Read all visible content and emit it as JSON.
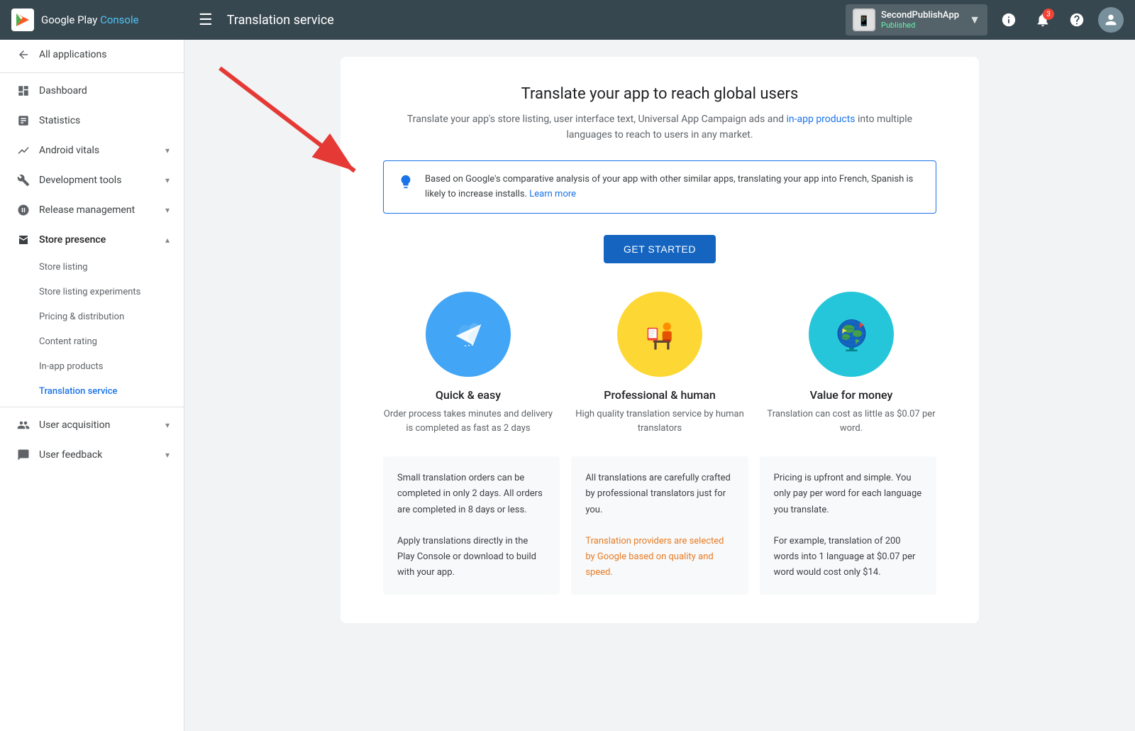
{
  "header": {
    "hamburger": "☰",
    "page_title": "Translation service",
    "app": {
      "name": "SecondPublishApp",
      "status": "Published",
      "chevron": "▼"
    },
    "icons": {
      "help": "?",
      "notifications_badge": "3",
      "help2": "?"
    }
  },
  "sidebar": {
    "logo_text_1": "Google Play",
    "logo_text_2": "Console",
    "nav": [
      {
        "id": "all-apps",
        "label": "All applications",
        "icon": "←",
        "level": 0
      },
      {
        "id": "dashboard",
        "label": "Dashboard",
        "icon": "⊞",
        "level": 0
      },
      {
        "id": "statistics",
        "label": "Statistics",
        "icon": "📊",
        "level": 0
      },
      {
        "id": "android-vitals",
        "label": "Android vitals",
        "icon": "📈",
        "level": 0,
        "has_chevron": true
      },
      {
        "id": "development-tools",
        "label": "Development tools",
        "icon": "🔧",
        "level": 0,
        "has_chevron": true
      },
      {
        "id": "release-management",
        "label": "Release management",
        "icon": "🎯",
        "level": 0,
        "has_chevron": true
      },
      {
        "id": "store-presence",
        "label": "Store presence",
        "icon": "🛍",
        "level": 0,
        "has_chevron": true,
        "expanded": true
      },
      {
        "id": "store-listing",
        "label": "Store listing",
        "level": 1
      },
      {
        "id": "store-listing-experiments",
        "label": "Store listing experiments",
        "level": 1
      },
      {
        "id": "pricing-distribution",
        "label": "Pricing & distribution",
        "level": 1
      },
      {
        "id": "content-rating",
        "label": "Content rating",
        "level": 1
      },
      {
        "id": "in-app-products",
        "label": "In-app products",
        "level": 1
      },
      {
        "id": "translation-service",
        "label": "Translation service",
        "level": 1,
        "active": true
      },
      {
        "id": "user-acquisition",
        "label": "User acquisition",
        "icon": "👥",
        "level": 0,
        "has_chevron": true
      },
      {
        "id": "user-feedback",
        "label": "User feedback",
        "icon": "💬",
        "level": 0,
        "has_chevron": true
      }
    ]
  },
  "main": {
    "heading": "Translate your app to reach global users",
    "subtext": "Translate your app's store listing, user interface text, Universal App Campaign ads and",
    "subtext_link": "in-app products",
    "subtext_end": "into multiple languages to reach to users in any market.",
    "info_box": {
      "text": "Based on Google's comparative analysis of your app with other similar apps, translating your app into French, Spanish is likely to increase installs.",
      "link": "Learn more"
    },
    "get_started_btn": "GET STARTED",
    "features": [
      {
        "id": "quick-easy",
        "title": "Quick & easy",
        "desc": "Order process takes minutes and delivery is completed as fast as 2 days",
        "color": "blue"
      },
      {
        "id": "professional-human",
        "title": "Professional & human",
        "desc": "High quality translation service by human translators",
        "color": "yellow"
      },
      {
        "id": "value-for-money",
        "title": "Value for money",
        "desc": "Translation can cost as little as $0.07 per word.",
        "color": "teal"
      }
    ],
    "details": [
      {
        "text1": "Small translation orders can be completed in only 2 days. All orders are completed in 8 days or less.",
        "text2": "Apply translations directly in the Play Console or download to build with your app."
      },
      {
        "text1": "All translations are carefully crafted by professional translators just for you.",
        "text2_highlight": "Translation providers are selected by Google based on quality and speed."
      },
      {
        "text1": "Pricing is upfront and simple. You only pay per word for each language you translate.",
        "text2": "For example, translation of 200 words into 1 language at $0.07 per word would cost only $14."
      }
    ]
  }
}
